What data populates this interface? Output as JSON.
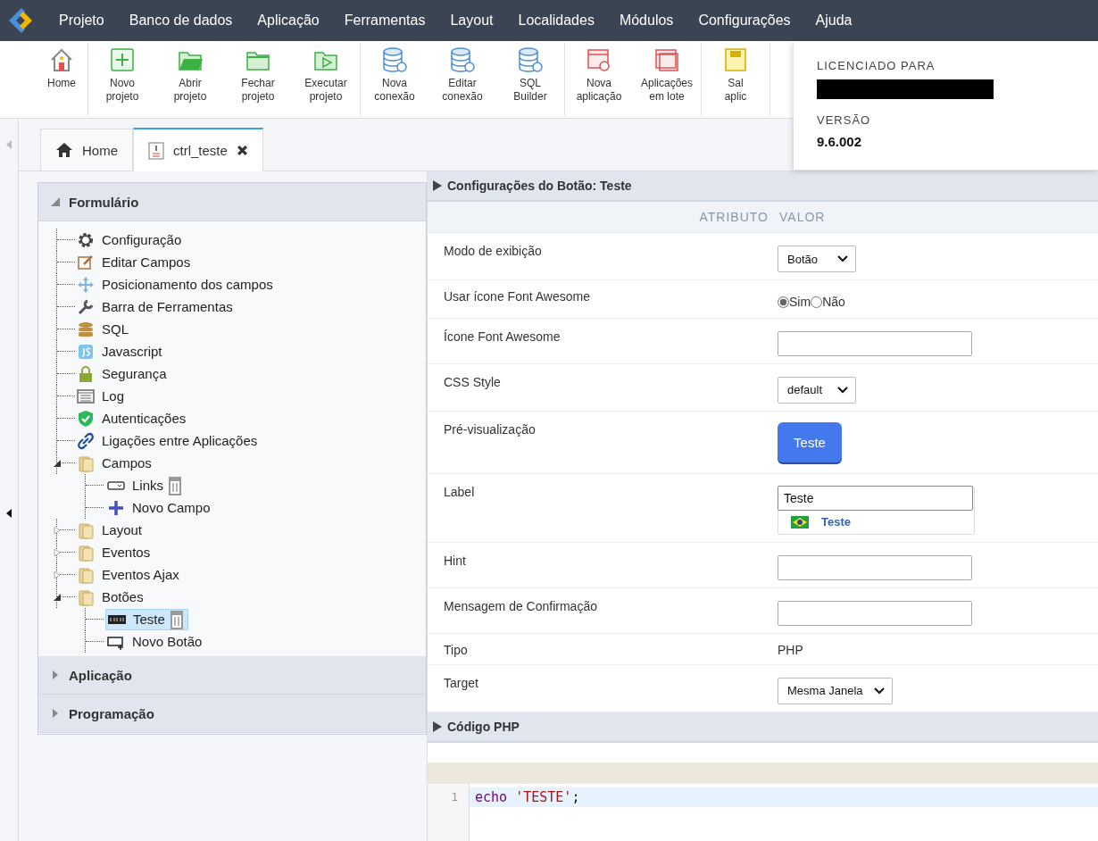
{
  "menu": [
    "Projeto",
    "Banco de dados",
    "Aplicação",
    "Ferramentas",
    "Layout",
    "Localidades",
    "Módulos",
    "Configurações",
    "Ajuda"
  ],
  "toolbar": [
    [
      {
        "kind": "home",
        "lines": [
          "Home"
        ]
      }
    ],
    [
      {
        "kind": "new",
        "lines": [
          "Novo",
          "projeto"
        ]
      },
      {
        "kind": "open",
        "lines": [
          "Abrir",
          "projeto"
        ]
      },
      {
        "kind": "close",
        "lines": [
          "Fechar",
          "projeto"
        ]
      },
      {
        "kind": "run",
        "lines": [
          "Executar",
          "projeto"
        ]
      }
    ],
    [
      {
        "kind": "dbnew",
        "lines": [
          "Nova",
          "conexão"
        ]
      },
      {
        "kind": "dbedit",
        "lines": [
          "Editar",
          "conexão"
        ]
      },
      {
        "kind": "dbsql",
        "lines": [
          "SQL",
          "Builder"
        ]
      }
    ],
    [
      {
        "kind": "appnew",
        "lines": [
          "Nova",
          "aplicação"
        ]
      },
      {
        "kind": "appbatch",
        "lines": [
          "Aplicações",
          "em lote"
        ]
      }
    ],
    [
      {
        "kind": "save",
        "lines": [
          "Sal",
          "aplic"
        ]
      }
    ]
  ],
  "license": {
    "licensed_label": "LICENCIADO PARA",
    "version_label": "VERSÃO",
    "version": "9.6.002"
  },
  "tabs": [
    {
      "label": "Home",
      "kind": "home",
      "selected": false,
      "closable": false
    },
    {
      "label": "ctrl_teste",
      "kind": "form",
      "selected": true,
      "closable": true
    }
  ],
  "sidebar": [
    {
      "title": "Formulário",
      "expanded": true,
      "tree": [
        {
          "label": "Configuração",
          "kind": "gear"
        },
        {
          "label": "Editar Campos",
          "kind": "edit"
        },
        {
          "label": "Posicionamento dos campos",
          "kind": "move"
        },
        {
          "label": "Barra de Ferramentas",
          "kind": "wrench"
        },
        {
          "label": "SQL",
          "kind": "db"
        },
        {
          "label": "Javascript",
          "kind": "js"
        },
        {
          "label": "Segurança",
          "kind": "lock"
        },
        {
          "label": "Log",
          "kind": "log"
        },
        {
          "label": "Autenticações",
          "kind": "shield"
        },
        {
          "label": "Ligações entre Aplicações",
          "kind": "link"
        },
        {
          "label": "Campos",
          "kind": "folder",
          "expanded": true,
          "children": [
            {
              "label": "Links",
              "kind": "field",
              "selected": false,
              "deletable": true
            },
            {
              "label": "Novo Campo",
              "kind": "plus",
              "selected": false,
              "deletable": false
            }
          ]
        },
        {
          "label": "Layout",
          "kind": "folder",
          "expanded": false
        },
        {
          "label": "Eventos",
          "kind": "folder",
          "expanded": false
        },
        {
          "label": "Eventos Ajax",
          "kind": "folder",
          "expanded": false
        },
        {
          "label": "Botões",
          "kind": "folder",
          "expanded": true,
          "children": [
            {
              "label": "Teste",
              "kind": "btn",
              "selected": true,
              "deletable": true
            },
            {
              "label": "Novo Botão",
              "kind": "addbtn",
              "selected": false,
              "deletable": false
            }
          ]
        }
      ]
    },
    {
      "title": "Aplicação",
      "expanded": false
    },
    {
      "title": "Programação",
      "expanded": false
    }
  ],
  "settings": {
    "title": "Configurações do Botão: Teste",
    "columns": [
      "ATRIBUTO",
      "VALOR"
    ],
    "rows": [
      {
        "label": "Modo de exibição",
        "kind": "select",
        "value": "Botão"
      },
      {
        "label": "Usar ícone Font Awesome",
        "kind": "radio",
        "options": [
          {
            "label": "Sim",
            "selected": true
          },
          {
            "label": "Não",
            "selected": false
          }
        ]
      },
      {
        "label": "Ícone Font Awesome",
        "kind": "input",
        "value": ""
      },
      {
        "label": "CSS Style",
        "kind": "select",
        "value": "default"
      },
      {
        "label": "Pré-visualização",
        "kind": "preview",
        "value": "Teste"
      },
      {
        "label": "Label",
        "kind": "label",
        "value": "Teste",
        "translation": "Teste"
      },
      {
        "label": "Hint",
        "kind": "input",
        "value": ""
      },
      {
        "label": "Mensagem de Confirmação",
        "kind": "input",
        "value": ""
      },
      {
        "label": "Tipo",
        "kind": "text",
        "value": "PHP"
      },
      {
        "label": "Target",
        "kind": "select",
        "value": "Mesma Janela"
      }
    ]
  },
  "code": {
    "title": "Código PHP",
    "lines": [
      {
        "number": "1",
        "keyword": "echo",
        "string": "'TESTE'",
        "end": ";"
      }
    ]
  }
}
